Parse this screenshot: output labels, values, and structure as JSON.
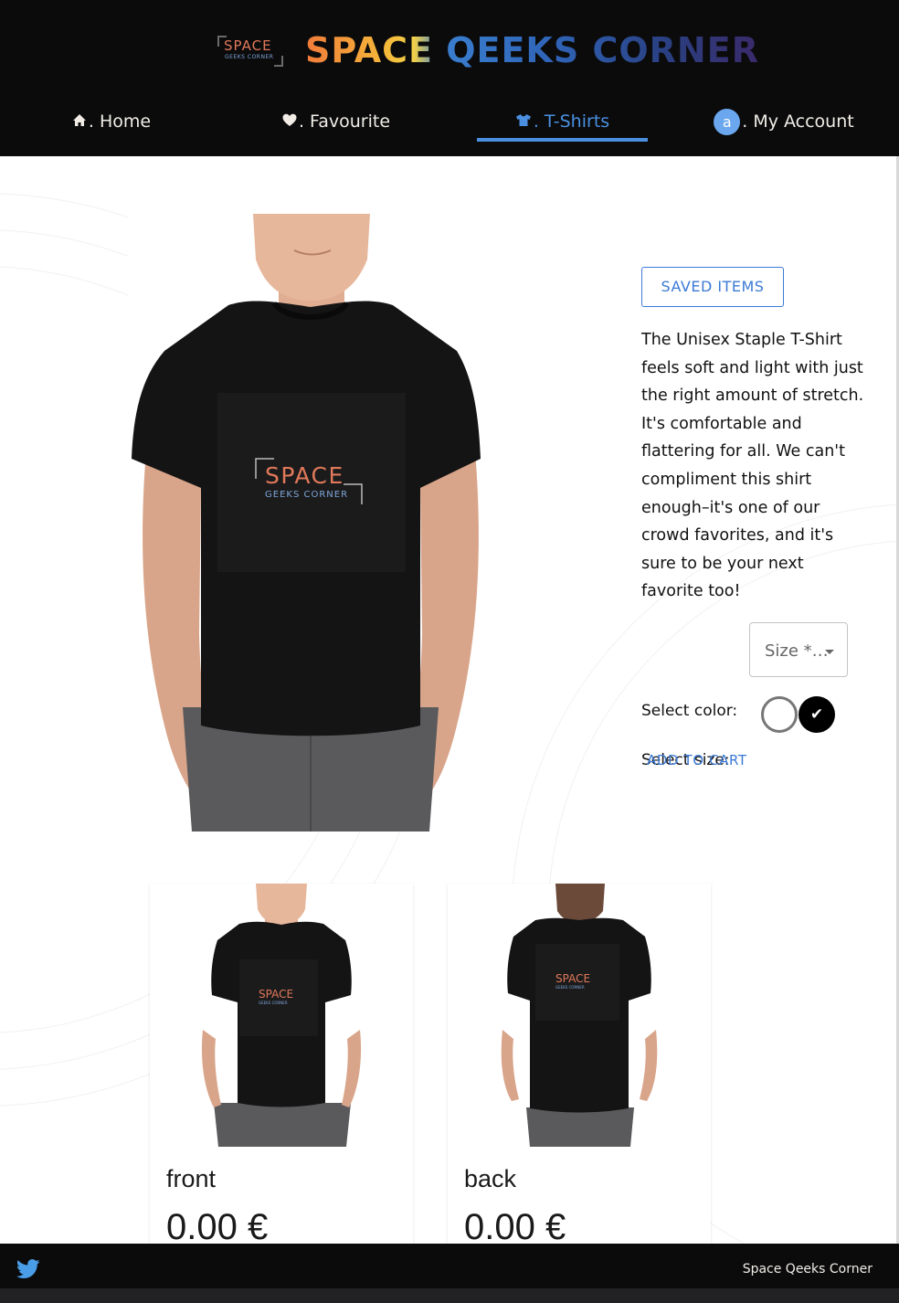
{
  "header": {
    "logo_line1": "SPACE",
    "logo_line2": "GEEKS CORNER",
    "title": "SPACE QEEKS CORNER"
  },
  "nav": {
    "items": [
      {
        "label": ". Home",
        "icon": "home-icon"
      },
      {
        "label": ". Favourite",
        "icon": "heart-icon"
      },
      {
        "label": ". T-Shirts",
        "icon": "tshirt-icon",
        "active": true
      },
      {
        "label": ". My Account",
        "icon": "avatar",
        "avatar_letter": "a"
      }
    ]
  },
  "product": {
    "saved_items_label": "SAVED ITEMS",
    "description": "The Unisex Staple T-Shirt feels soft and light with just the right amount of stretch. It's comfortable and flattering for all. We can't compliment this shirt enough–it's one of our crowd favorites, and it's sure to be your next favorite too!",
    "select_size_label": "Select size:",
    "size_placeholder": "Size *…",
    "select_color_label": "Select color:",
    "colors": [
      "#ffffff",
      "#000000"
    ],
    "selected_color_index": 1,
    "selected_mark": "✔",
    "add_to_cart_label": "ADD TO CART",
    "shirt_print_line1": "SPACE",
    "shirt_print_line2": "GEEKS CORNER"
  },
  "cards": [
    {
      "name": "front",
      "price": "0.00 €"
    },
    {
      "name": "back",
      "price": "0.00 €"
    }
  ],
  "footer": {
    "brand": "Space Qeeks Corner"
  },
  "colors": {
    "header_bg": "#0b0b0c",
    "accent": "#4a8fe0",
    "button_blue": "#3b7ad6",
    "logo_orange": "#e0785a",
    "logo_blue": "#7fa6d8"
  }
}
